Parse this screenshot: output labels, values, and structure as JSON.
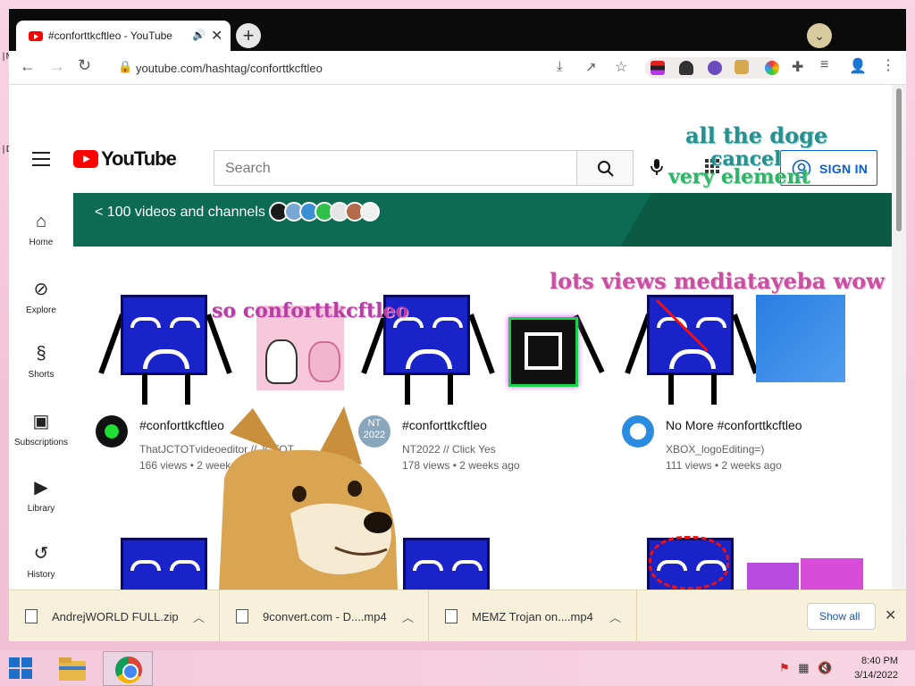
{
  "browser": {
    "tab_title": "#conforttkcftleo - YouTube",
    "url": "youtube.com/hashtag/conforttkcftleo"
  },
  "youtube": {
    "logo_text": "YouTube",
    "search_placeholder": "Search",
    "signin_label": "SIGN IN",
    "sidebar": [
      {
        "label": "Home",
        "icon": "home-icon"
      },
      {
        "label": "Explore",
        "icon": "compass-icon"
      },
      {
        "label": "Shorts",
        "icon": "shorts-icon"
      },
      {
        "label": "Subscriptions",
        "icon": "subscriptions-icon"
      },
      {
        "label": "Library",
        "icon": "library-icon"
      },
      {
        "label": "History",
        "icon": "history-icon"
      }
    ],
    "banner_text": "< 100 videos and channels",
    "videos": [
      {
        "title": "#conforttkcftleo",
        "channel": "ThatJCTOTvideoeditor // JCTOT",
        "meta": "166 views • 2 weeks ago"
      },
      {
        "title": "#conforttkcftleo",
        "channel": "NT2022 // Click Yes",
        "meta": "178 views • 2 weeks ago",
        "avatar_text_1": "NT",
        "avatar_text_2": "2022"
      },
      {
        "title": "No More #conforttkcftleo",
        "channel": "XBOX_logoEditing=)",
        "meta": "111 views • 2 weeks ago"
      }
    ]
  },
  "overlays": {
    "top_1": "all the doge",
    "top_2": "cancel",
    "top_3": "very element",
    "mid": "lots views mediatayeba wow",
    "thumb": "so conforttkcftleo"
  },
  "downloads": {
    "items": [
      "AndrejWORLD FULL.zip",
      "9convert.com - D....mp4",
      "MEMZ Trojan on....mp4"
    ],
    "show_all": "Show all"
  },
  "taskbar": {
    "time": "8:40 PM",
    "date": "3/14/2022"
  },
  "colors": {
    "youtube_red": "#ff0000",
    "banner_green": "#0c6b52",
    "signin_blue": "#065fd4",
    "overlay_teal": "#2a8f8f",
    "overlay_pink": "#c94fa0"
  }
}
